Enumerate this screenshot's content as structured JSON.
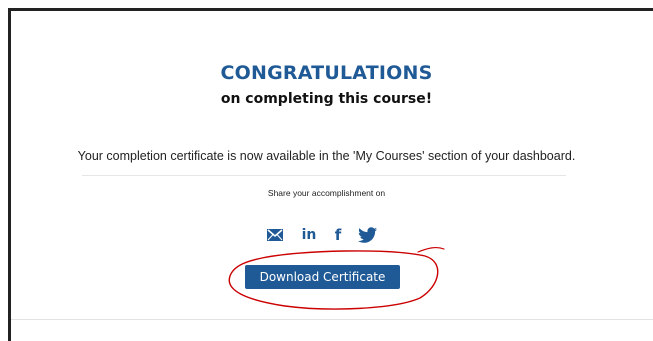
{
  "header": {
    "title": "CONGRATULATIONS",
    "subtitle": "on completing this course!"
  },
  "message": {
    "text": "Your completion certificate is now available in the 'My Courses' section of your dashboard."
  },
  "share": {
    "label": "Share your accomplishment on",
    "icons": [
      "email-icon",
      "linkedin-icon",
      "facebook-icon",
      "twitter-icon"
    ],
    "linkedin_glyph": "in",
    "facebook_glyph": "f"
  },
  "actions": {
    "download_label": "Download Certificate"
  },
  "colors": {
    "brand": "#1f5a96",
    "annotation": "#cc0000",
    "text": "#222222"
  }
}
